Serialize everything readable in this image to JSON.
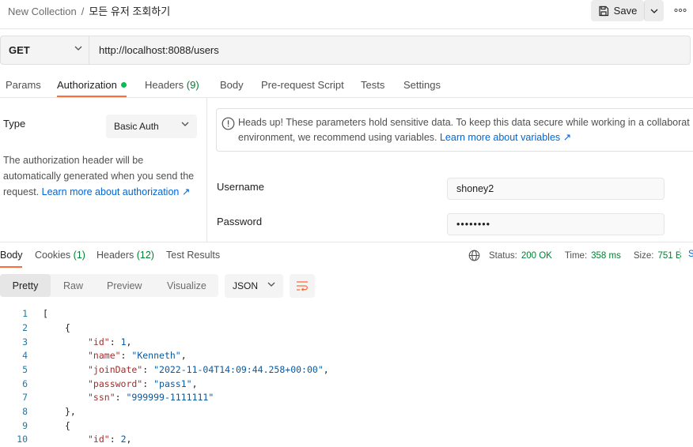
{
  "breadcrumb": {
    "collection": "New Collection",
    "separator": "/",
    "request": "모든 유저 조회하기"
  },
  "toolbar": {
    "save_label": "Save"
  },
  "request": {
    "method": "GET",
    "url": "http://localhost:8088/users"
  },
  "request_tabs": {
    "params": "Params",
    "authorization": "Authorization",
    "headers": "Headers",
    "headers_count": "(9)",
    "body": "Body",
    "pre_request": "Pre-request Script",
    "tests": "Tests",
    "settings": "Settings"
  },
  "auth": {
    "type_label": "Type",
    "type_value": "Basic Auth",
    "help_text": "The authorization header will be automatically generated when you send the request. ",
    "help_link": "Learn more about authorization ↗",
    "warning_line1": "Heads up! These parameters hold sensitive data. To keep this data secure while working in a collaborat",
    "warning_line2": "environment, we recommend using variables. ",
    "warning_link": "Learn more about variables ↗",
    "username_label": "Username",
    "username_value": "shoney2",
    "password_label": "Password",
    "password_value": "••••••••"
  },
  "response_tabs": {
    "body": "Body",
    "cookies": "Cookies",
    "cookies_count": "(1)",
    "headers": "Headers",
    "headers_count": "(12)",
    "test_results": "Test Results"
  },
  "status": {
    "status_label": "Status:",
    "status_value": "200 OK",
    "time_label": "Time:",
    "time_value": "358 ms",
    "size_label": "Size:",
    "size_value": "751 B",
    "cut_text": "S"
  },
  "view": {
    "pretty": "Pretty",
    "raw": "Raw",
    "preview": "Preview",
    "visualize": "Visualize",
    "format": "JSON"
  },
  "code": {
    "line_numbers": [
      "1",
      "2",
      "3",
      "4",
      "5",
      "6",
      "7",
      "8",
      "9",
      "10"
    ],
    "open_bracket": "[",
    "open_brace": "{",
    "close_brace_comma": "},",
    "id_key": "\"id\"",
    "id_value_1": "1",
    "id_value_2": "2",
    "name_key": "\"name\"",
    "name_value": "\"Kenneth\"",
    "joinDate_key": "\"joinDate\"",
    "joinDate_value": "\"2022-11-04T14:09:44.258+00:00\"",
    "password_key": "\"password\"",
    "password_value": "\"pass1\"",
    "ssn_key": "\"ssn\"",
    "ssn_value": "\"999999-1111111\""
  },
  "colors": {
    "accent": "#ff6c37",
    "link": "#0265d2",
    "success": "#007f31",
    "dot": "#0cbb52"
  }
}
